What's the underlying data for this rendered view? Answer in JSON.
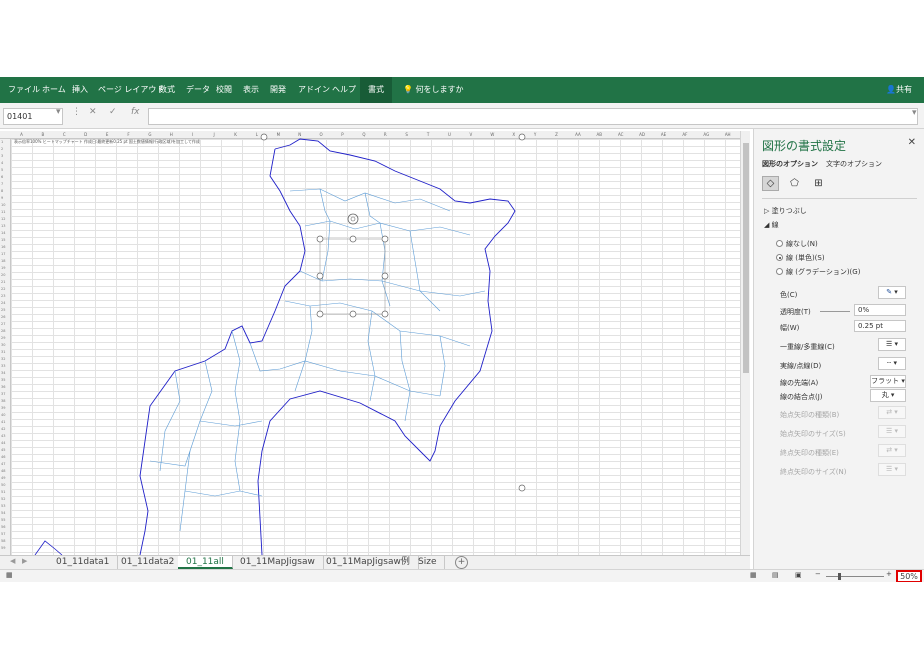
{
  "ribbon": {
    "tabs": [
      {
        "label": "ファイル"
      },
      {
        "label": "ホーム"
      },
      {
        "label": "挿入"
      },
      {
        "label": "ページ レイアウト"
      },
      {
        "label": "数式"
      },
      {
        "label": "データ"
      },
      {
        "label": "校閲"
      },
      {
        "label": "表示"
      },
      {
        "label": "開発"
      },
      {
        "label": "アドイン"
      },
      {
        "label": "ヘルプ"
      },
      {
        "label": "書式"
      }
    ],
    "active_tab": "書式",
    "tell_me": "何をしますか",
    "share": "共有",
    "color": "#217346"
  },
  "formula_bar": {
    "name_box": "01401",
    "cancel_icon": "✕",
    "enter_icon": "✓",
    "fx_label": "fx"
  },
  "sheet": {
    "columns": [
      "A",
      "B",
      "C",
      "D",
      "E",
      "F",
      "G",
      "H",
      "I",
      "J",
      "K",
      "L",
      "M",
      "N",
      "O",
      "P",
      "Q",
      "R",
      "S",
      "T",
      "U",
      "V",
      "W",
      "X",
      "Y",
      "Z",
      "AA",
      "AB",
      "AC",
      "AD",
      "AE",
      "AF",
      "AG",
      "AH"
    ],
    "header_note": "表示倍率100%  ヒートマップチャート  作成日:最終更新0.25 pt  国土数値情報(行政区域)を加工して作成"
  },
  "sheet_tabs": {
    "tabs": [
      {
        "label": "01_11data1"
      },
      {
        "label": "01_11data2"
      },
      {
        "label": "01_11all"
      },
      {
        "label": "01_11MapJigsaw"
      },
      {
        "label": "01_11MapJigsaw例"
      },
      {
        "label": "Size"
      }
    ],
    "active": "01_11all"
  },
  "status": {
    "zoom": "50%"
  },
  "format_pane": {
    "title": "図形の書式設定",
    "options": [
      {
        "label": "図形のオプション"
      },
      {
        "label": "文字のオプション"
      }
    ],
    "sections": {
      "fill": "塗りつぶし",
      "line": "線"
    },
    "line_options": [
      {
        "label": "線なし(N)",
        "selected": false
      },
      {
        "label": "線 (単色)(S)",
        "selected": true
      },
      {
        "label": "線 (グラデーション)(G)",
        "selected": false
      }
    ],
    "props": {
      "color": "色(C)",
      "transparency": "透明度(T)",
      "transparency_value": "0%",
      "width": "幅(W)",
      "width_value": "0.25 pt",
      "compound": "一重線/多重線(C)",
      "dash": "実線/点線(D)",
      "cap": "線の先端(A)",
      "cap_value": "フラット",
      "join": "線の結合点(J)",
      "join_value": "丸",
      "begin_arrow_type": "始点矢印の種類(B)",
      "begin_arrow_size": "始点矢印のサイズ(S)",
      "end_arrow_type": "終点矢印の種類(E)",
      "end_arrow_size": "終点矢印のサイズ(N)"
    },
    "accent": "#217346"
  },
  "map": {
    "outer_color": "#1f1fc8",
    "inner_color": "#5b9bd5"
  }
}
